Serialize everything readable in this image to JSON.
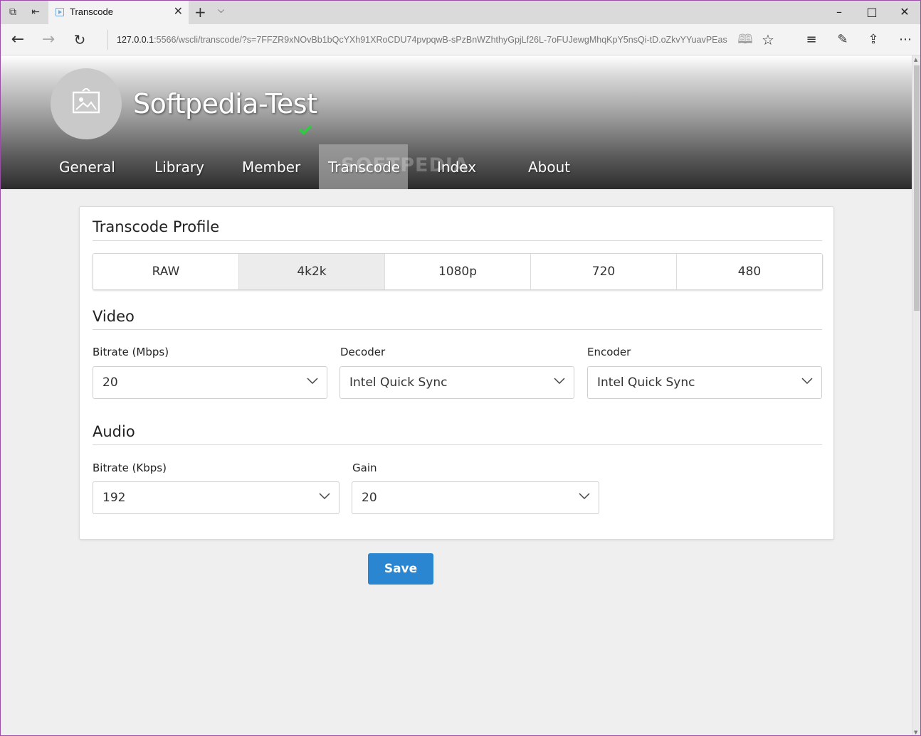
{
  "browser": {
    "tab_title": "Transcode",
    "url_host": "127.0.0.1",
    "url_rest": ":5566/wscli/transcode/?s=7FFZR9xNOvBb1bQcYXh91XRoCDU74pvpqwB-sPzBnWZhthyGpjLf26L-7oFUJewgMhqKpY5nsQi-tD.oZkvYYuavPEas"
  },
  "header": {
    "server_name": "Softpedia-Test",
    "watermark": "SOFTPEDIA",
    "tabs": [
      {
        "label": "General"
      },
      {
        "label": "Library"
      },
      {
        "label": "Member"
      },
      {
        "label": "Transcode"
      },
      {
        "label": "Index"
      },
      {
        "label": "About"
      }
    ],
    "active_tab": "Transcode"
  },
  "profile_section": {
    "title": "Transcode Profile",
    "options": [
      "RAW",
      "4k2k",
      "1080p",
      "720",
      "480"
    ],
    "selected": "4k2k"
  },
  "video": {
    "title": "Video",
    "bitrate_label": "Bitrate (Mbps)",
    "bitrate_value": "20",
    "decoder_label": "Decoder",
    "decoder_value": "Intel Quick Sync",
    "encoder_label": "Encoder",
    "encoder_value": "Intel Quick Sync"
  },
  "audio": {
    "title": "Audio",
    "bitrate_label": "Bitrate (Kbps)",
    "bitrate_value": "192",
    "gain_label": "Gain",
    "gain_value": "20"
  },
  "actions": {
    "save_label": "Save"
  },
  "colors": {
    "accent": "#2a86d1",
    "verified": "#2ecc40",
    "page_bg": "#efefef"
  }
}
